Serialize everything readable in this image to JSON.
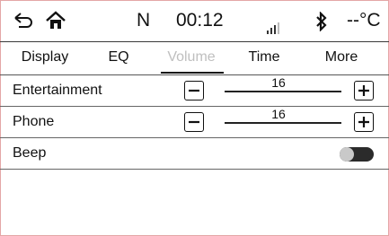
{
  "status_bar": {
    "gear": "N",
    "time": "00:12",
    "temperature": "--°C",
    "icons": [
      "back-icon",
      "home-icon",
      "signal-icon",
      "bluetooth-icon"
    ]
  },
  "tabs": [
    {
      "label": "Display",
      "active": false
    },
    {
      "label": "EQ",
      "active": false
    },
    {
      "label": "Volume",
      "active": true
    },
    {
      "label": "Time",
      "active": false
    },
    {
      "label": "More",
      "active": false
    }
  ],
  "settings": {
    "entertainment": {
      "label": "Entertainment",
      "value": "16"
    },
    "phone": {
      "label": "Phone",
      "value": "16"
    },
    "beep": {
      "label": "Beep",
      "enabled": false
    }
  },
  "colors": {
    "frame": "#e4a6a6",
    "active_tab_text": "#bfbfbf",
    "toggle_track": "#2b2b2b",
    "toggle_knob": "#c9c9c9"
  }
}
